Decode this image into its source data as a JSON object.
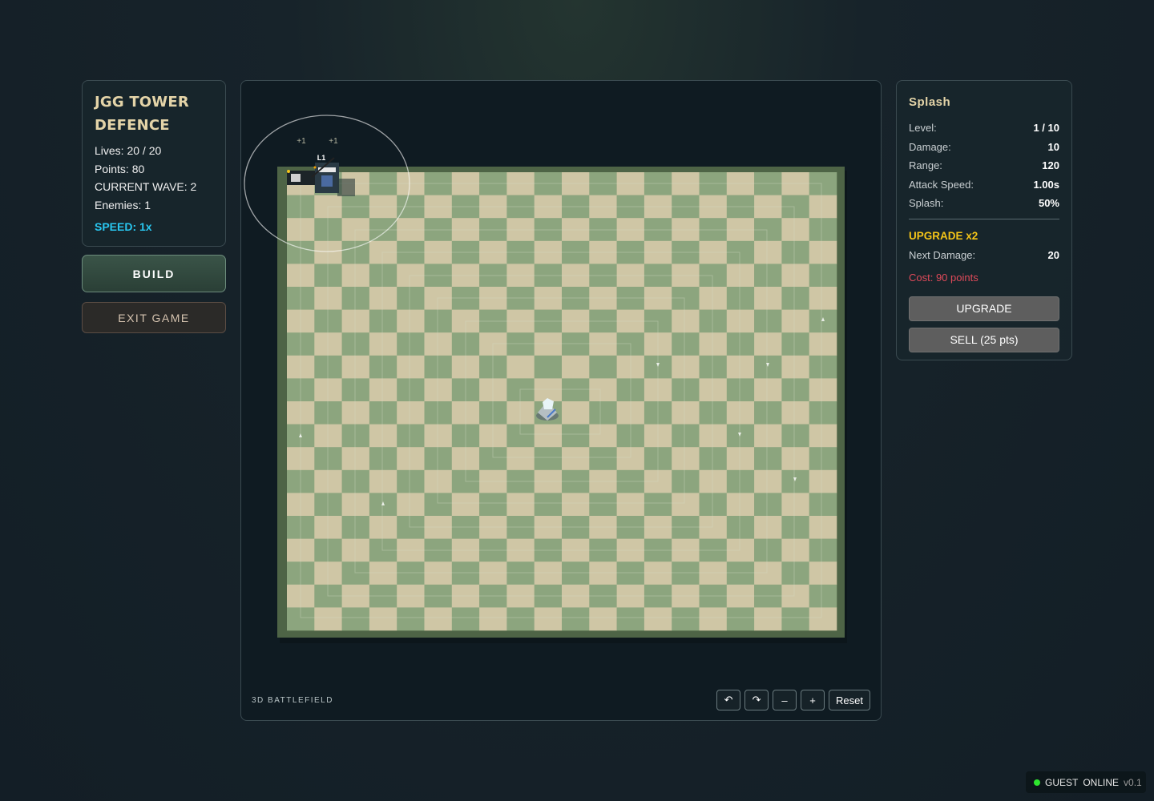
{
  "game": {
    "title_line1": "JGG TOWER",
    "title_line2": "DEFENCE",
    "lives": "Lives: 20 / 20",
    "points": "Points: 80",
    "wave": "CURRENT WAVE: 2",
    "enemies": "Enemies: 1",
    "speed": "SPEED: 1x"
  },
  "menu": {
    "build": "BUILD",
    "exit": "EXIT GAME"
  },
  "battlefield": {
    "label": "3D BATTLEFIELD",
    "float_text": [
      "+1",
      "+1"
    ],
    "tower_level": "L1",
    "grid": {
      "cols": 20,
      "rows": 20
    },
    "colors": {
      "light_tile": "#cfc6a5",
      "dark_tile": "#8ca57e",
      "board_border": "#4e6446"
    },
    "controls": {
      "rotate_left": "↶",
      "rotate_right": "↷",
      "zoom_out": "–",
      "zoom_in": "+",
      "reset": "Reset"
    }
  },
  "tower": {
    "name": "Splash",
    "stats": [
      {
        "label": "Level:",
        "value": "1 / 10"
      },
      {
        "label": "Damage:",
        "value": "10"
      },
      {
        "label": "Range:",
        "value": "120"
      },
      {
        "label": "Attack Speed:",
        "value": "1.00s"
      },
      {
        "label": "Splash:",
        "value": "50%"
      }
    ],
    "upgrade": {
      "title": "UPGRADE x2",
      "next_label": "Next Damage:",
      "next_value": "20",
      "cost": "Cost: 90 points",
      "button": "UPGRADE"
    },
    "sell_button": "SELL (25 pts)"
  },
  "status": {
    "user": "GUEST",
    "state": "ONLINE",
    "version": "v0.1"
  }
}
